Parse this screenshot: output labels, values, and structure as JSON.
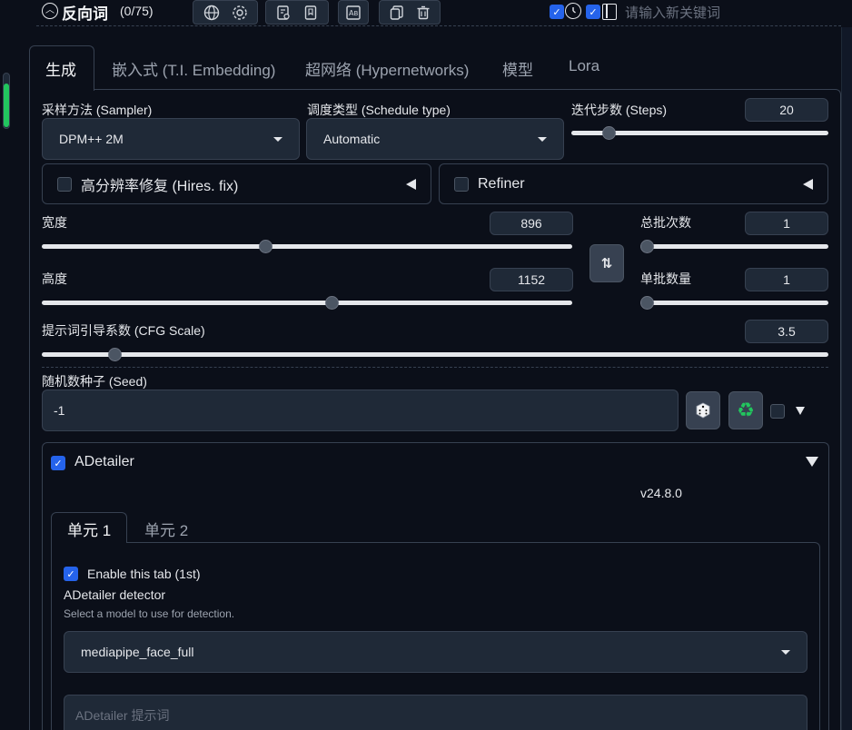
{
  "negative": {
    "title": "反向词",
    "count": "(0/75)"
  },
  "keyword": {
    "placeholder": "请输入新关键词"
  },
  "tabs": [
    "生成",
    "嵌入式 (T.I. Embedding)",
    "超网络 (Hypernetworks)",
    "模型",
    "Lora"
  ],
  "sampler": {
    "label": "采样方法 (Sampler)",
    "value": "DPM++ 2M"
  },
  "schedule": {
    "label": "调度类型 (Schedule type)",
    "value": "Automatic"
  },
  "steps": {
    "label": "迭代步数 (Steps)",
    "value": "20",
    "min": 1,
    "max": 150
  },
  "hires": {
    "label": "高分辨率修复 (Hires. fix)"
  },
  "refiner": {
    "label": "Refiner"
  },
  "width": {
    "label": "宽度",
    "value": "896",
    "min": 64,
    "max": 2048
  },
  "height": {
    "label": "高度",
    "value": "1152",
    "min": 64,
    "max": 2048
  },
  "batch_count": {
    "label": "总批次数",
    "value": "1",
    "min": 1,
    "max": 100
  },
  "batch_size": {
    "label": "单批数量",
    "value": "1",
    "min": 1,
    "max": 8
  },
  "cfg": {
    "label": "提示词引导系数 (CFG Scale)",
    "value": "3.5",
    "min": 1,
    "max": 30
  },
  "seed": {
    "label": "随机数种子 (Seed)",
    "value": "-1"
  },
  "adetailer": {
    "title": "ADetailer",
    "version": "v24.8.0",
    "units": [
      "单元 1",
      "单元 2"
    ],
    "enable_label": "Enable this tab (1st)",
    "detector_label": "ADetailer detector",
    "detector_hint": "Select a model to use for detection.",
    "detector_value": "mediapipe_face_full",
    "prompt_placeholder": "ADetailer 提示词"
  }
}
